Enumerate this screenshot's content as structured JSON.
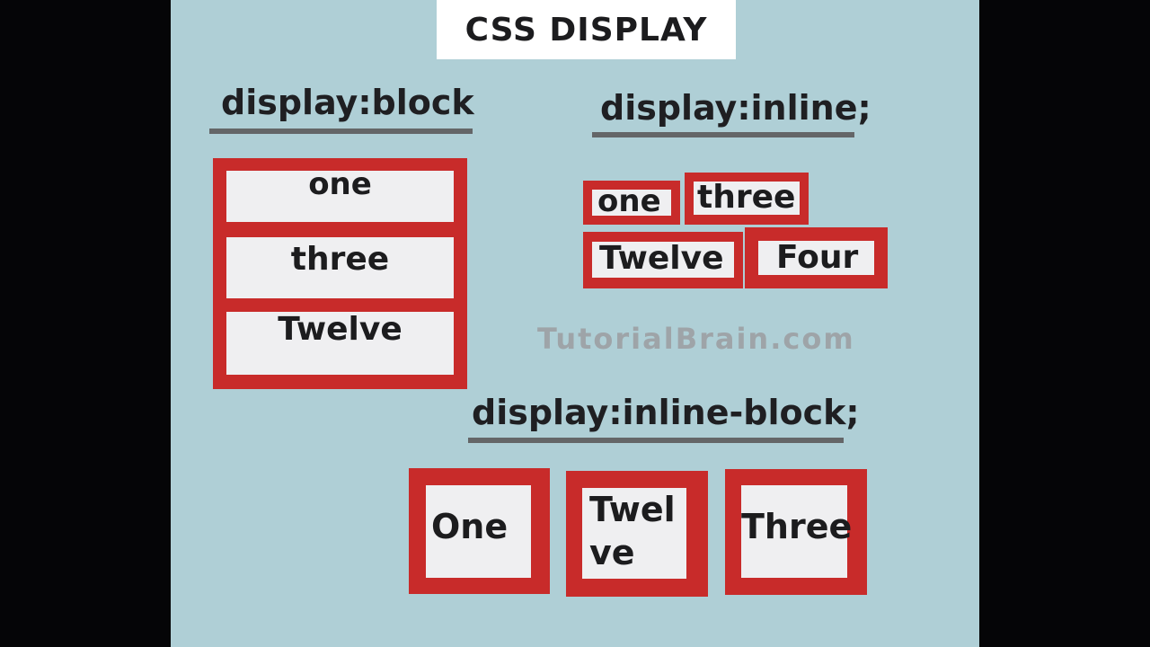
{
  "title": "CSS DISPLAY",
  "watermark": "TutorialBrain.com",
  "colors": {
    "background": "#afcfd6",
    "box_border": "#c82b2a",
    "box_fill": "#efeff1",
    "underline": "#646668",
    "text": "#1c1c1e",
    "frame": "#050507"
  },
  "block_section": {
    "heading": "display:block",
    "items": [
      "one",
      "three",
      "Twelve"
    ]
  },
  "inline_section": {
    "heading": "display:inline;",
    "items": [
      "one",
      "three",
      "Twelve",
      "Four"
    ]
  },
  "inline_block_section": {
    "heading": "display:inline-block;",
    "items": [
      "One",
      "Twel",
      "ve",
      "Three"
    ]
  }
}
